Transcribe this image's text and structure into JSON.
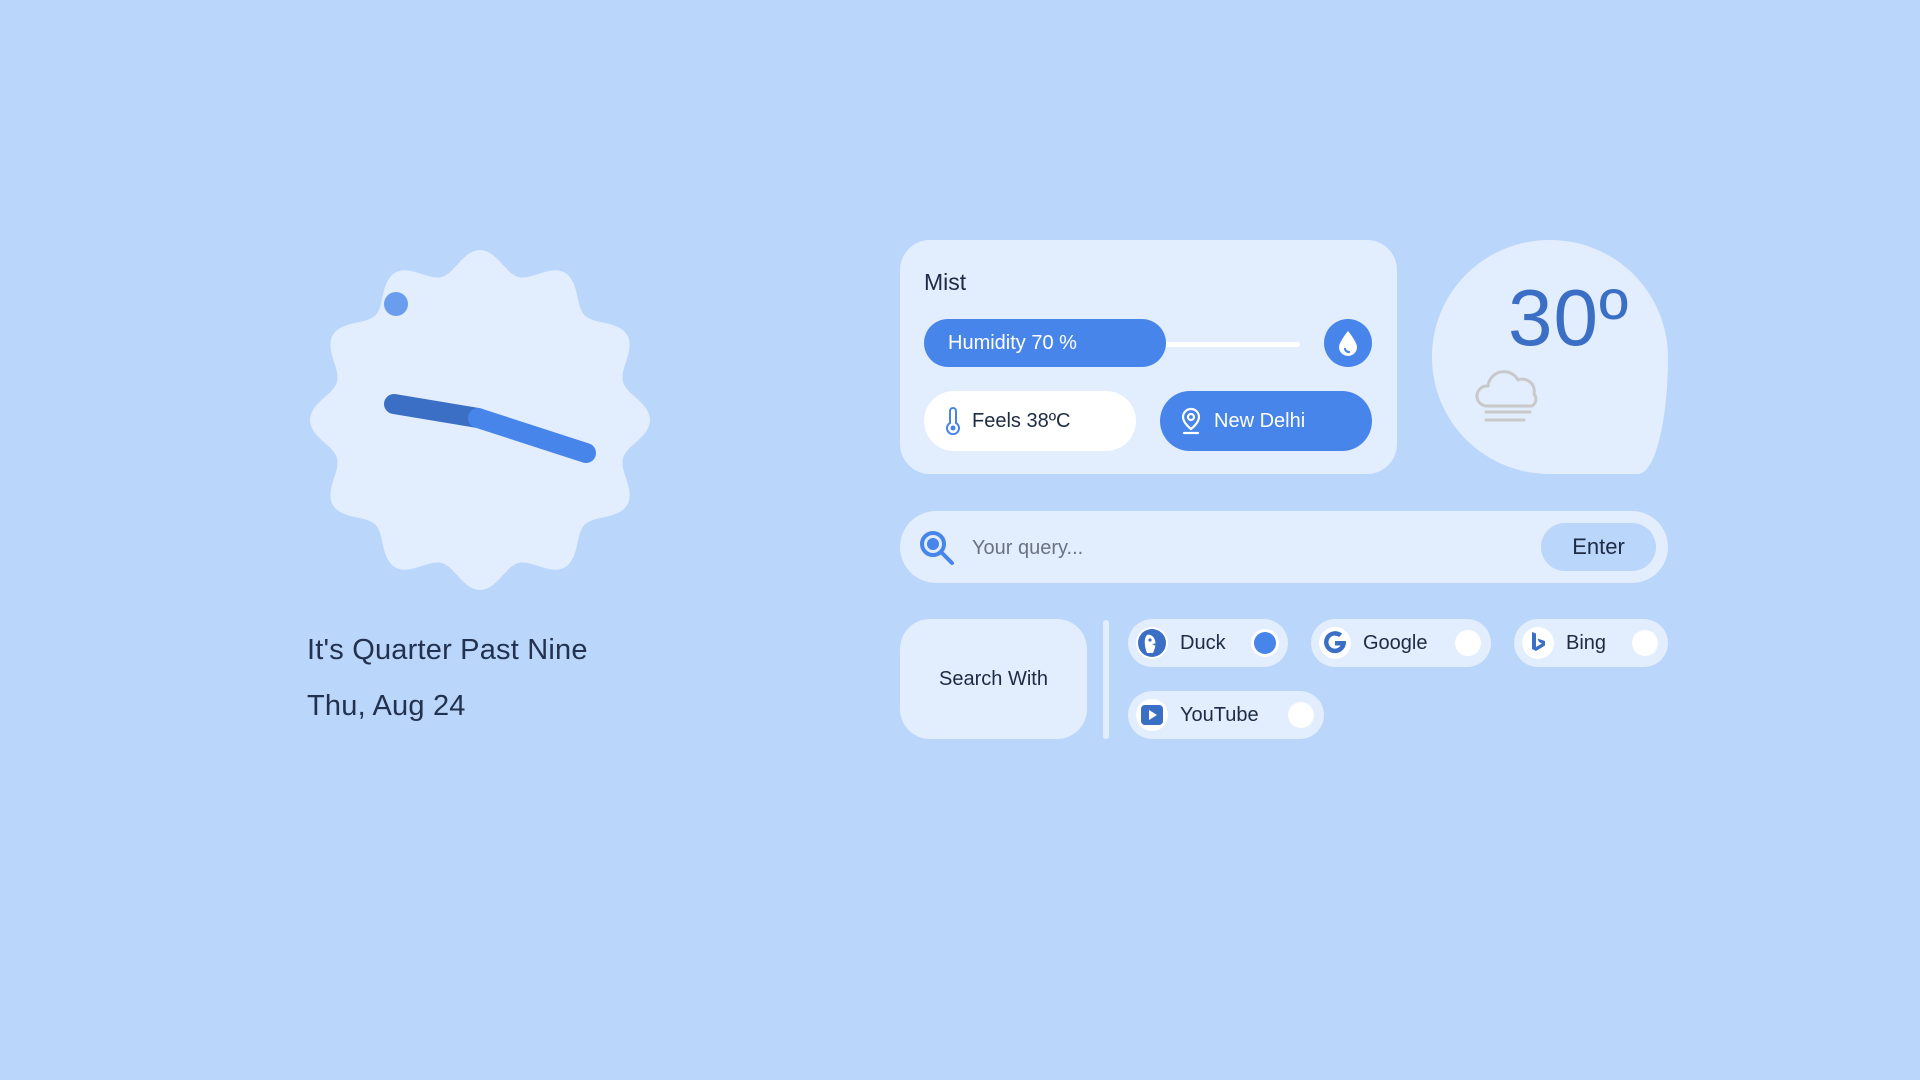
{
  "clock": {
    "caption": "It's Quarter Past Nine",
    "date": "Thu, Aug 24"
  },
  "weather": {
    "condition": "Mist",
    "humidity_label": "Humidity 70 %",
    "humidity_percent": 70,
    "feels_label": "Feels 38ºC",
    "location_label": "New Delhi",
    "temperature": "30º",
    "icons": {
      "humidity": "water-drop-icon",
      "feels": "thermometer-icon",
      "location": "location-pin-icon",
      "condition": "mist-cloud-icon"
    }
  },
  "search": {
    "placeholder": "Your query...",
    "enter_label": "Enter",
    "icon": "search-icon"
  },
  "engines": {
    "heading": "Search With",
    "items": [
      {
        "label": "Duck",
        "icon": "duckduckgo-icon",
        "selected": true
      },
      {
        "label": "Google",
        "icon": "google-icon",
        "selected": false
      },
      {
        "label": "Bing",
        "icon": "bing-icon",
        "selected": false
      },
      {
        "label": "YouTube",
        "icon": "youtube-icon",
        "selected": false
      }
    ]
  },
  "colors": {
    "background": "#bbd6fb",
    "card": "#e2edfd",
    "accent": "#4885ea",
    "accent_dark": "#3a6fc5"
  }
}
